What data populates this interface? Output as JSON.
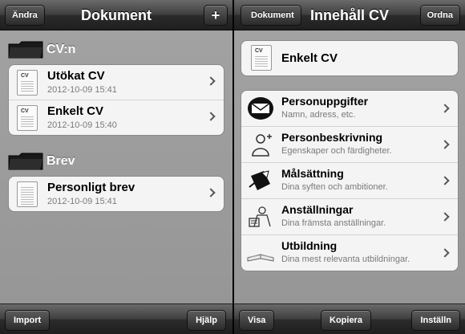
{
  "left": {
    "nav": {
      "title": "Dokument",
      "left_button": "Ändra",
      "right_button": "+"
    },
    "sections": [
      {
        "label": "CV:n",
        "items": [
          {
            "title": "Utökat CV",
            "date": "2012-10-09 15:41",
            "icon": "cv-document-icon"
          },
          {
            "title": "Enkelt CV",
            "date": "2012-10-09 15:40",
            "icon": "cv-document-icon"
          }
        ]
      },
      {
        "label": "Brev",
        "items": [
          {
            "title": "Personligt brev",
            "date": "2012-10-09 15:41",
            "icon": "letter-document-icon"
          }
        ]
      }
    ],
    "toolbar": {
      "left": "Import",
      "right": "Hjälp"
    }
  },
  "right": {
    "nav": {
      "title": "Innehåll CV",
      "back_button": "Dokument",
      "right_button": "Ordna"
    },
    "document_name": "Enkelt CV",
    "items": [
      {
        "title": "Personuppgifter",
        "subtitle": "Namn, adress, etc.",
        "icon": "envelope-icon"
      },
      {
        "title": "Personbeskrivning",
        "subtitle": "Egenskaper och färdigheter.",
        "icon": "person-icon"
      },
      {
        "title": "Målsättning",
        "subtitle": "Dina syften och ambitioner.",
        "icon": "target-arrow-icon"
      },
      {
        "title": "Anställningar",
        "subtitle": "Dina främsta anställningar.",
        "icon": "worker-icon"
      },
      {
        "title": "Utbildning",
        "subtitle": "Dina mest relevanta utbildningar.",
        "icon": "open-book-icon"
      }
    ],
    "toolbar": {
      "left": "Visa",
      "center": "Kopiera",
      "right": "Inställn"
    }
  }
}
